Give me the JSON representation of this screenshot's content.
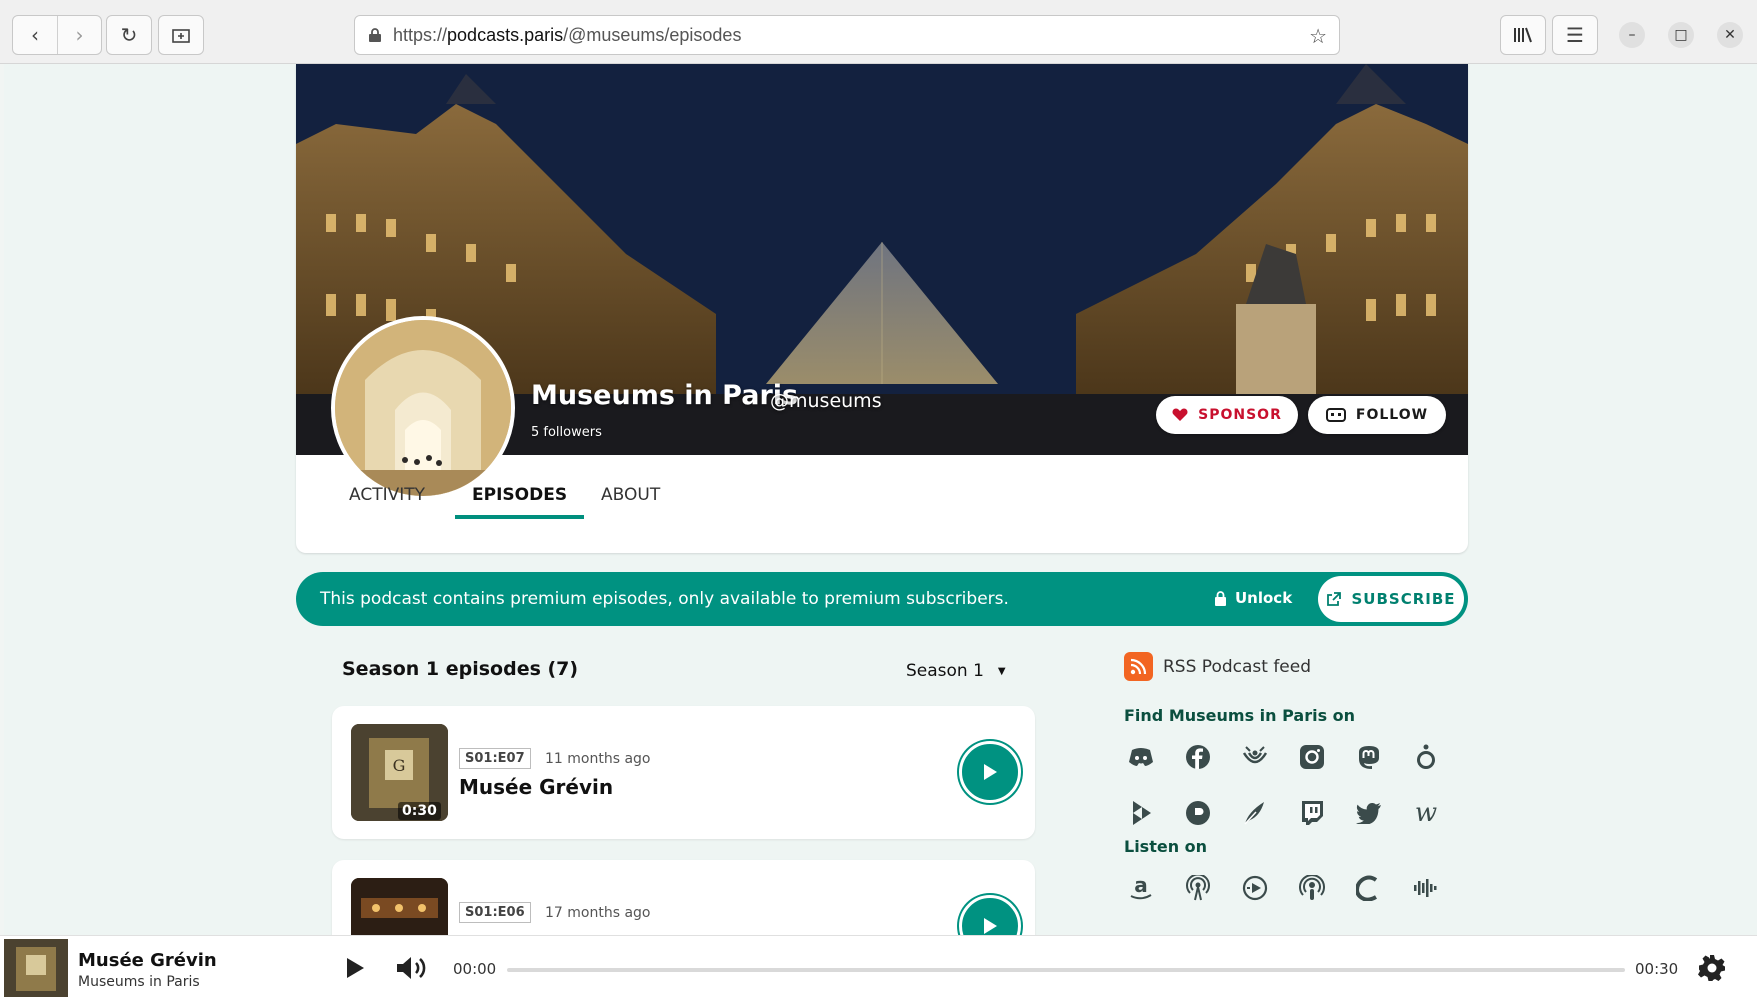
{
  "browser": {
    "url_scheme": "https://",
    "url_host": "podcasts.paris",
    "url_path": "/@museums/episodes"
  },
  "podcast": {
    "title": "Museums in Paris",
    "handle": "@museums",
    "followers": "5 followers",
    "sponsor_label": "SPONSOR",
    "follow_label": "FOLLOW"
  },
  "tabs": [
    {
      "label": "ACTIVITY",
      "active": false
    },
    {
      "label": "EPISODES",
      "active": true
    },
    {
      "label": "ABOUT",
      "active": false
    }
  ],
  "premium": {
    "message": "This podcast contains premium episodes, only available to premium subscribers.",
    "unlock_label": "Unlock",
    "subscribe_label": "SUBSCRIBE"
  },
  "season": {
    "title": "Season 1 episodes (7)",
    "selected": "Season 1"
  },
  "episodes": [
    {
      "code": "S01:E07",
      "date": "11 months ago",
      "title": "Musée Grévin",
      "duration": "0:30"
    },
    {
      "code": "S01:E06",
      "date": "17 months ago",
      "title": "",
      "duration": ""
    }
  ],
  "sidebar": {
    "rss_label": "RSS Podcast feed",
    "find_heading": "Find Museums in Paris on",
    "listen_heading": "Listen on",
    "social_icons": [
      "discord-icon",
      "facebook-icon",
      "funkwhale-icon",
      "instagram-icon",
      "mastodon-icon",
      "odysee-icon",
      "peertube-icon",
      "pixelfed-icon",
      "pleroma-icon",
      "twitch-icon",
      "twitter-icon",
      "writefreely-icon"
    ],
    "listen_icons": [
      "amazon-icon",
      "antennapod-icon",
      "anytime-icon",
      "apple-podcasts-icon",
      "castopod-icon",
      "castbox-icon"
    ]
  },
  "player": {
    "title": "Musée Grévin",
    "subtitle": "Museums in Paris",
    "time_current": "00:00",
    "time_total": "00:30",
    "progress": 0
  },
  "colors": {
    "accent": "#009281",
    "sponsor": "#c8102e",
    "rss": "#f26522"
  }
}
